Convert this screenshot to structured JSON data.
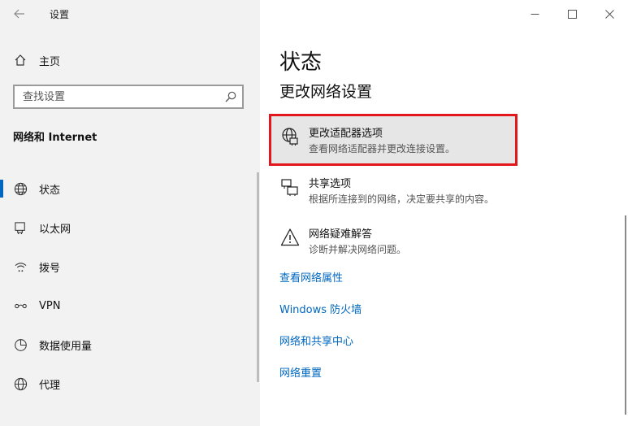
{
  "window": {
    "title": "设置",
    "controls": {
      "minimize": "—",
      "maximize": "☐",
      "close": "✕"
    }
  },
  "sidebar": {
    "home_label": "主页",
    "search_placeholder": "查找设置",
    "section_title": "网络和 Internet",
    "items": [
      {
        "label": "状态",
        "icon": "globe-icon",
        "active": true
      },
      {
        "label": "以太网",
        "icon": "ethernet-icon",
        "active": false
      },
      {
        "label": "拨号",
        "icon": "dialup-icon",
        "active": false
      },
      {
        "label": "VPN",
        "icon": "vpn-icon",
        "active": false
      },
      {
        "label": "数据使用量",
        "icon": "data-usage-icon",
        "active": false
      },
      {
        "label": "代理",
        "icon": "proxy-globe-icon",
        "active": false
      }
    ]
  },
  "main": {
    "title": "状态",
    "subtitle": "更改网络设置",
    "options": [
      {
        "title": "更改适配器选项",
        "desc": "查看网络适配器并更改连接设置。",
        "icon": "adapter-globe-icon",
        "highlighted": true
      },
      {
        "title": "共享选项",
        "desc": "根据所连接到的网络，决定要共享的内容。",
        "icon": "sharing-icon",
        "highlighted": false
      },
      {
        "title": "网络疑难解答",
        "desc": "诊断并解决网络问题。",
        "icon": "warning-icon",
        "highlighted": false
      }
    ],
    "links": [
      "查看网络属性",
      "Windows 防火墙",
      "网络和共享中心",
      "网络重置"
    ]
  },
  "colors": {
    "accent": "#0067c0",
    "highlight_border": "#e2161b",
    "sidebar_bg": "#f2f2f2"
  }
}
